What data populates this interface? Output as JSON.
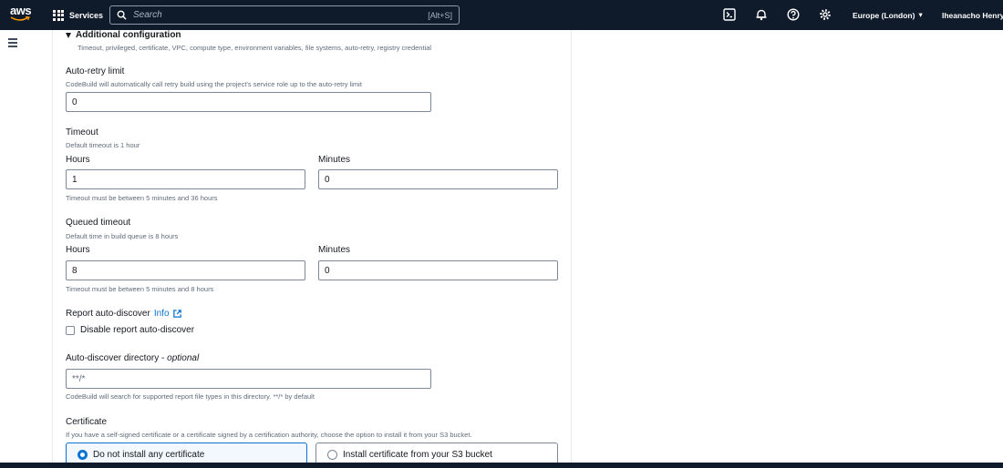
{
  "topnav": {
    "logo_text": "aws",
    "services_label": "Services",
    "search_placeholder": "Search",
    "search_shortcut": "[Alt+S]",
    "region": "Europe (London)",
    "user": "Iheanacho Henry"
  },
  "additional_config": {
    "title": "Additional configuration",
    "description": "Timeout, privileged, certificate, VPC, compute type, environment variables, file systems, auto-retry, registry credential"
  },
  "auto_retry": {
    "label": "Auto-retry limit",
    "description": "CodeBuild will automatically call retry build using the project's service role up to the auto-retry limit",
    "value": "0"
  },
  "timeout": {
    "label": "Timeout",
    "description": "Default timeout is 1 hour",
    "hours_label": "Hours",
    "hours_value": "1",
    "minutes_label": "Minutes",
    "minutes_value": "0",
    "constraint": "Timeout must be between 5 minutes and 36 hours"
  },
  "queued_timeout": {
    "label": "Queued timeout",
    "description": "Default time in build queue is 8 hours",
    "hours_label": "Hours",
    "hours_value": "8",
    "minutes_label": "Minutes",
    "minutes_value": "0",
    "constraint": "Timeout must be between 5 minutes and 8 hours"
  },
  "report_auto_discover": {
    "label": "Report auto-discover",
    "info_link": "Info",
    "checkbox_label": "Disable report auto-discover",
    "checked": false
  },
  "auto_discover_dir": {
    "label": "Auto-discover directory",
    "optional": "optional",
    "placeholder": "**/*",
    "description": "CodeBuild will search for supported report file types in this directory. **/* by default"
  },
  "certificate": {
    "label": "Certificate",
    "description": "If you have a self-signed certificate or a certificate signed by a certification authority, choose the option to install it from your S3 bucket.",
    "options": [
      {
        "label": "Do not install any certificate",
        "selected": true
      },
      {
        "label": "Install certificate from your S3 bucket",
        "selected": false
      }
    ]
  },
  "colors": {
    "nav_bg": "#0f1b2a",
    "accent": "#0972d3"
  }
}
